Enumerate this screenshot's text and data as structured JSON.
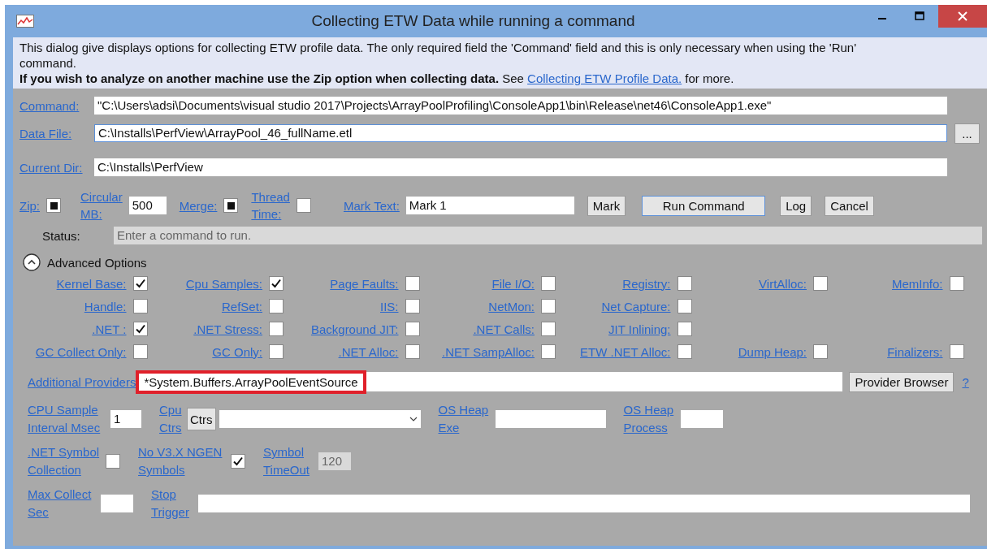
{
  "window": {
    "title": "Collecting ETW Data while running a command"
  },
  "description": {
    "line1": "This dialog give displays options for collecting ETW profile data. The only required field the 'Command' field and this is only necessary when using the 'Run' command.",
    "line2": "**If you wish to analyze on another machine use the Zip option when collecting data.** See ",
    "link": "Collecting ETW Profile Data.",
    "line2_after": " for more."
  },
  "fields": [
    {
      "label": "Command:",
      "value": "\"C:\\Users\\adsi\\Documents\\visual studio 2017\\Projects\\ArrayPoolProfiling\\ConsoleApp1\\bin\\Release\\net46\\ConsoleApp1.exe\"",
      "focused": false
    },
    {
      "label": "Data File:",
      "value": "C:\\Installs\\PerfView\\ArrayPool_46_fullName.etl",
      "focused": true,
      "browse": "..."
    },
    {
      "label": "Current Dir:",
      "value": "C:\\Installs\\PerfView",
      "focused": false
    }
  ],
  "settings": [
    {
      "kind": "checkbox",
      "label": "Zip:",
      "indeterminate": true
    },
    {
      "kind": "field",
      "label": "Circular\nMB:",
      "value": "500"
    },
    {
      "kind": "checkbox",
      "label": "Merge:",
      "indeterminate": true
    },
    {
      "kind": "checkbox",
      "label": "Thread\nTime:",
      "checked": false,
      "indeterminate": false
    },
    {
      "kind": "field",
      "label": "Mark Text:",
      "value": "Mark 1"
    },
    {
      "kind": "button",
      "label": "Mark",
      "default": false
    },
    {
      "kind": "button",
      "label": "Run Command",
      "default": true
    },
    {
      "kind": "button",
      "label": "Log",
      "default": false
    },
    {
      "kind": "button",
      "label": "Cancel",
      "default": false
    }
  ],
  "status": {
    "label": "Status:",
    "value": "Enter a command to run."
  },
  "advanced": {
    "label": "Advanced Options",
    "expanded": true
  },
  "options": [
    [
      {
        "label": "Kernel Base:",
        "checked": true
      },
      {
        "label": "Cpu Samples:",
        "checked": true
      },
      {
        "label": "Page Faults:",
        "checked": false
      },
      {
        "label": "File I/O:",
        "checked": false
      },
      {
        "label": "Registry:",
        "checked": false
      },
      {
        "label": "VirtAlloc:",
        "checked": false
      },
      {
        "label": "MemInfo:",
        "checked": false
      }
    ],
    [
      {
        "label": "Handle:",
        "checked": false
      },
      {
        "label": "RefSet:",
        "checked": false
      },
      {
        "label": "IIS:",
        "checked": false
      },
      {
        "label": "NetMon:",
        "checked": false
      },
      {
        "label": "Net Capture:",
        "checked": false
      }
    ],
    [
      {
        "label": ".NET :",
        "checked": true
      },
      {
        "label": ".NET Stress:",
        "checked": false
      },
      {
        "label": "Background JIT:",
        "checked": false
      },
      {
        "label": ".NET Calls:",
        "checked": false
      },
      {
        "label": "JIT Inlining:",
        "checked": false
      }
    ],
    [
      {
        "label": "GC Collect Only:",
        "checked": false
      },
      {
        "label": "GC Only:",
        "checked": false
      },
      {
        "label": ".NET Alloc:",
        "checked": false
      },
      {
        "label": ".NET SampAlloc:",
        "checked": false
      },
      {
        "label": "ETW .NET Alloc:",
        "checked": false
      },
      {
        "label": "Dump Heap:",
        "checked": false
      },
      {
        "label": "Finalizers:",
        "checked": false
      }
    ]
  ],
  "providers": {
    "label": "Additional Providers",
    "value": "*System.Buffers.ArrayPoolEventSource",
    "highlighted": true,
    "button": "Provider Browser",
    "help": "?"
  },
  "more": [
    [
      {
        "kind": "field",
        "label": "CPU Sample\nInterval Msec",
        "value": "1"
      },
      {
        "kind": "button-dropdown",
        "label": "Cpu\nCtrs",
        "button": "Ctrs"
      },
      {
        "kind": "field",
        "label": "OS Heap\nExe"
      },
      {
        "kind": "field",
        "label": "OS Heap\nProcess"
      }
    ],
    [
      {
        "kind": "checkbox",
        "label": ".NET Symbol\nCollection",
        "checked": false
      },
      {
        "kind": "checkbox",
        "label": "No V3.X NGEN\nSymbols",
        "checked": true
      },
      {
        "kind": "field",
        "label": "Symbol\nTimeOut",
        "value": "120",
        "disabled": true
      }
    ],
    [
      {
        "kind": "field",
        "label": "Max Collect\nSec"
      },
      {
        "kind": "field",
        "label": "Stop\nTrigger"
      }
    ]
  ]
}
